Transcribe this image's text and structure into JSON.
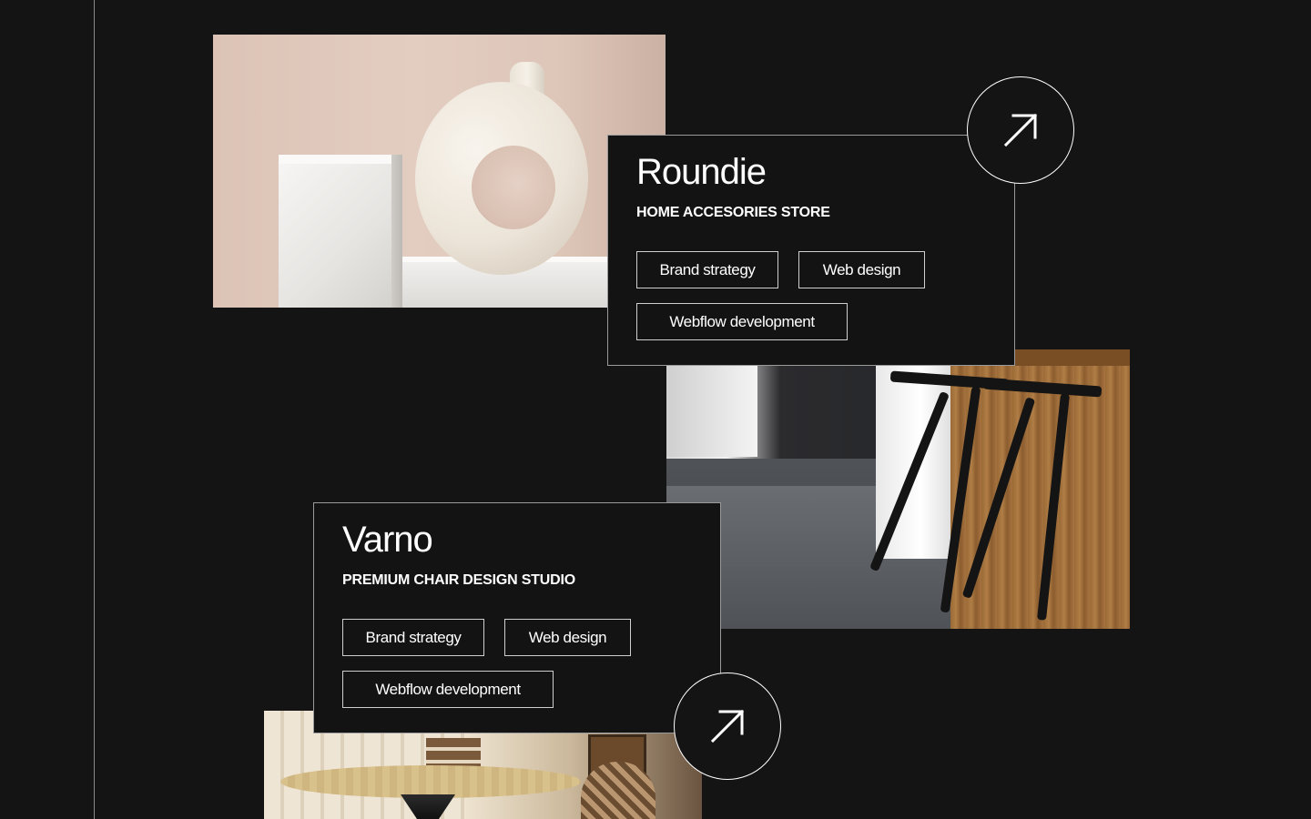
{
  "projects": [
    {
      "title": "Roundie",
      "subtitle": "HOME ACCESORIES STORE",
      "tags": [
        "Brand strategy",
        "Web design",
        "Webflow development"
      ]
    },
    {
      "title": "Varno",
      "subtitle": "PREMIUM CHAIR DESIGN STUDIO",
      "tags": [
        "Brand strategy",
        "Web design",
        "Webflow development"
      ]
    }
  ],
  "icons": {
    "project_link": "arrow-up-right-icon"
  },
  "colors": {
    "background": "#141414",
    "card_border": "#9a9a9a",
    "text": "#ffffff"
  }
}
